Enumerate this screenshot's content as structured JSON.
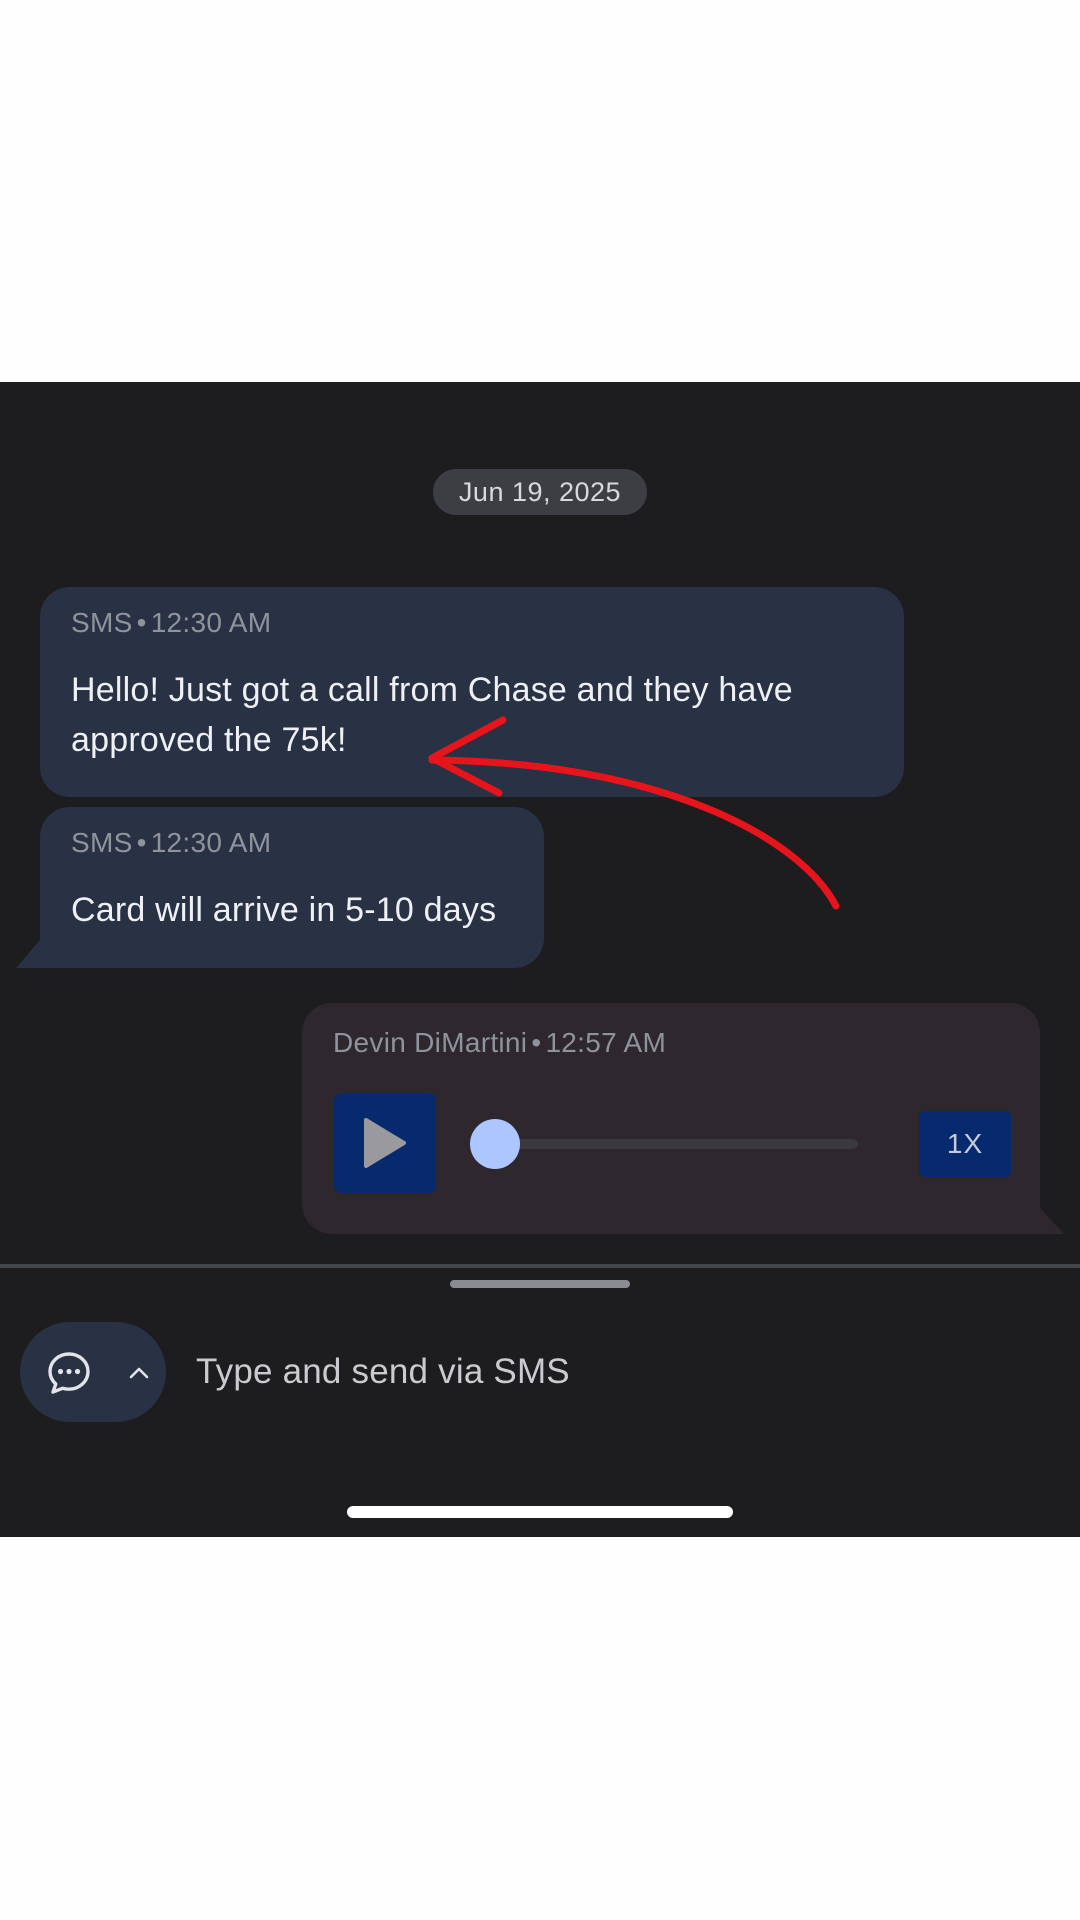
{
  "conversation": {
    "date_chip": "Jun 19, 2025",
    "messages": [
      {
        "direction": "incoming",
        "sender": "SMS",
        "separator": "•",
        "time": "12:30 AM",
        "text": "Hello! Just got a call from Chase and they have approved the 75k!"
      },
      {
        "direction": "incoming",
        "sender": "SMS",
        "separator": "•",
        "time": "12:30 AM",
        "text": "Card will arrive in 5-10 days"
      },
      {
        "direction": "outgoing",
        "type": "voice",
        "sender": "Devin DiMartini",
        "separator": "•",
        "time": "12:57 AM",
        "playback_speed": "1X",
        "playback_progress": 0,
        "play_icon": "play-icon"
      }
    ]
  },
  "composer": {
    "placeholder": "Type and send via SMS",
    "toggle_icons": [
      "chat-bubble-icon",
      "chevron-up-icon"
    ]
  },
  "annotation": {
    "type": "red-arrow",
    "color": "#e8141b"
  },
  "colors": {
    "background": "#1d1d1f",
    "incoming_bubble": "#293145",
    "outgoing_bubble": "#2e272e",
    "accent": "#aec6ff",
    "button_blue": "#062a6d"
  }
}
